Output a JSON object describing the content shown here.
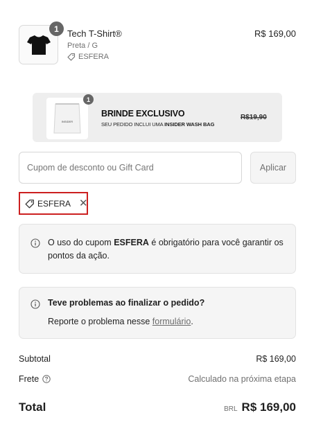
{
  "product": {
    "quantity": "1",
    "name": "Tech T-Shirt®",
    "variant": "Preta / G",
    "discount_code": "ESFERA",
    "price": "R$ 169,00"
  },
  "gift": {
    "quantity": "1",
    "thumb_text": "INSIDER",
    "title": "BRINDE EXCLUSIVO",
    "subtitle_prefix": "SEU PEDIDO INCLUI UMA",
    "subtitle_item": "INSIDER WASH BAG",
    "old_price": "R$19,90"
  },
  "coupon": {
    "placeholder": "Cupom de desconto ou Gift Card",
    "apply_label": "Aplicar",
    "applied_code": "ESFERA"
  },
  "info_coupon": {
    "text_before": "O uso do cupom",
    "code": "ESFERA",
    "text_after": "é obrigatório para você garantir os pontos da ação."
  },
  "info_problem": {
    "title": "Teve problemas ao finalizar o pedido?",
    "body_before": "Reporte o problema nesse",
    "link_label": "formulário",
    "body_after": "."
  },
  "summary": {
    "subtotal_label": "Subtotal",
    "subtotal_value": "R$ 169,00",
    "shipping_label": "Frete",
    "shipping_value": "Calculado na próxima etapa",
    "total_label": "Total",
    "currency": "BRL",
    "total_value": "R$ 169,00"
  }
}
